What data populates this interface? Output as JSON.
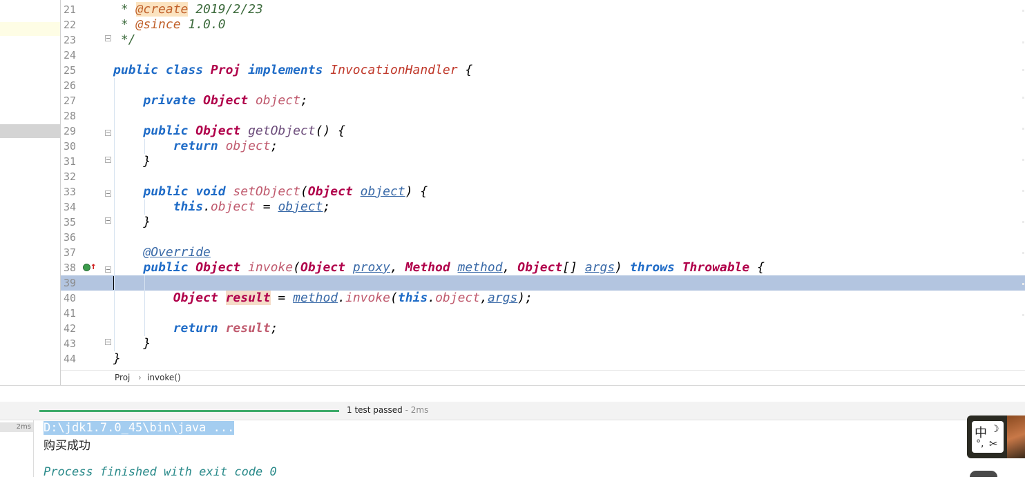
{
  "editor": {
    "lines": [
      {
        "n": "21",
        "segs": [
          {
            "c": "cmt",
            "t": " * "
          },
          {
            "c": "tag-hl",
            "t": "@create"
          },
          {
            "c": "cmt",
            "t": " 2019/2/23"
          }
        ]
      },
      {
        "n": "22",
        "segs": [
          {
            "c": "cmt",
            "t": " * "
          },
          {
            "c": "tag",
            "t": "@since"
          },
          {
            "c": "cmt",
            "t": " 1.0.0"
          }
        ]
      },
      {
        "n": "23",
        "segs": [
          {
            "c": "cmt",
            "t": " */"
          }
        ]
      },
      {
        "n": "24",
        "segs": []
      },
      {
        "n": "25",
        "segs": [
          {
            "c": "kw",
            "t": "public class "
          },
          {
            "c": "type",
            "t": "Proj "
          },
          {
            "c": "kw",
            "t": "implements "
          },
          {
            "c": "iface",
            "t": "InvocationHandler"
          },
          {
            "c": "",
            "t": " {"
          }
        ]
      },
      {
        "n": "26",
        "segs": []
      },
      {
        "n": "27",
        "segs": [
          {
            "c": "",
            "t": "    "
          },
          {
            "c": "kw",
            "t": "private "
          },
          {
            "c": "type",
            "t": "Object "
          },
          {
            "c": "fld",
            "t": "object"
          },
          {
            "c": "",
            "t": ";"
          }
        ]
      },
      {
        "n": "28",
        "segs": []
      },
      {
        "n": "29",
        "segs": [
          {
            "c": "",
            "t": "    "
          },
          {
            "c": "kw",
            "t": "public "
          },
          {
            "c": "type",
            "t": "Object "
          },
          {
            "c": "mth",
            "t": "getObject"
          },
          {
            "c": "",
            "t": "() {"
          }
        ]
      },
      {
        "n": "30",
        "segs": [
          {
            "c": "",
            "t": "        "
          },
          {
            "c": "kw",
            "t": "return "
          },
          {
            "c": "fld",
            "t": "object"
          },
          {
            "c": "",
            "t": ";"
          }
        ]
      },
      {
        "n": "31",
        "segs": [
          {
            "c": "",
            "t": "    }"
          }
        ]
      },
      {
        "n": "32",
        "segs": []
      },
      {
        "n": "33",
        "segs": [
          {
            "c": "",
            "t": "    "
          },
          {
            "c": "kw",
            "t": "public void "
          },
          {
            "c": "fld",
            "t": "setObject"
          },
          {
            "c": "",
            "t": "("
          },
          {
            "c": "type",
            "t": "Object "
          },
          {
            "c": "prm",
            "t": "object"
          },
          {
            "c": "",
            "t": ") {"
          }
        ]
      },
      {
        "n": "34",
        "segs": [
          {
            "c": "",
            "t": "        "
          },
          {
            "c": "kw",
            "t": "this"
          },
          {
            "c": "",
            "t": "."
          },
          {
            "c": "fld",
            "t": "object"
          },
          {
            "c": "",
            "t": " = "
          },
          {
            "c": "prm",
            "t": "object"
          },
          {
            "c": "",
            "t": ";"
          }
        ]
      },
      {
        "n": "35",
        "segs": [
          {
            "c": "",
            "t": "    }"
          }
        ]
      },
      {
        "n": "36",
        "segs": []
      },
      {
        "n": "37",
        "segs": [
          {
            "c": "",
            "t": "    "
          },
          {
            "c": "prm",
            "t": "@Override"
          }
        ]
      },
      {
        "n": "38",
        "segs": [
          {
            "c": "",
            "t": "    "
          },
          {
            "c": "kw",
            "t": "public "
          },
          {
            "c": "type",
            "t": "Object "
          },
          {
            "c": "fld",
            "t": "invoke"
          },
          {
            "c": "",
            "t": "("
          },
          {
            "c": "type",
            "t": "Object "
          },
          {
            "c": "prm",
            "t": "proxy"
          },
          {
            "c": "",
            "t": ", "
          },
          {
            "c": "type",
            "t": "Method "
          },
          {
            "c": "prm",
            "t": "method"
          },
          {
            "c": "",
            "t": ", "
          },
          {
            "c": "type",
            "t": "Object"
          },
          {
            "c": "",
            "t": "[] "
          },
          {
            "c": "prm",
            "t": "args"
          },
          {
            "c": "",
            "t": ") "
          },
          {
            "c": "kw",
            "t": "throws "
          },
          {
            "c": "type",
            "t": "Throwable"
          },
          {
            "c": "",
            "t": " {"
          }
        ]
      },
      {
        "n": "39",
        "segs": []
      },
      {
        "n": "40",
        "segs": [
          {
            "c": "",
            "t": "        "
          },
          {
            "c": "type",
            "t": "Object "
          },
          {
            "c": "var-hl",
            "t": "result"
          },
          {
            "c": "",
            "t": " = "
          },
          {
            "c": "prm",
            "t": "method"
          },
          {
            "c": "",
            "t": "."
          },
          {
            "c": "fld",
            "t": "invoke"
          },
          {
            "c": "",
            "t": "("
          },
          {
            "c": "kw",
            "t": "this"
          },
          {
            "c": "",
            "t": "."
          },
          {
            "c": "fld",
            "t": "object"
          },
          {
            "c": "",
            "t": ","
          },
          {
            "c": "prm",
            "t": "args"
          },
          {
            "c": "",
            "t": ");"
          }
        ]
      },
      {
        "n": "41",
        "segs": []
      },
      {
        "n": "42",
        "segs": [
          {
            "c": "",
            "t": "        "
          },
          {
            "c": "kw",
            "t": "return "
          },
          {
            "c": "loc",
            "t": "result"
          },
          {
            "c": "",
            "t": ";"
          }
        ]
      },
      {
        "n": "43",
        "segs": [
          {
            "c": "",
            "t": "    }"
          }
        ]
      },
      {
        "n": "44",
        "segs": [
          {
            "c": "",
            "t": "}"
          }
        ]
      }
    ]
  },
  "breadcrumb": {
    "items": [
      "Proj",
      "invoke()"
    ],
    "separator": "›"
  },
  "tests": {
    "status": "1 test passed",
    "time": " - 2ms",
    "badge": "2ms"
  },
  "console": {
    "command": "D:\\jdk1.7.0_45\\bin\\java ...",
    "output": "购买成功",
    "exit": "Process finished with exit code 0"
  },
  "ime": {
    "lang": "中",
    "moon": "☽",
    "punct": "°,",
    "fly": "✂"
  },
  "colors": {
    "selection": "#b3c5e0",
    "keyword": "#1e6bc7",
    "type": "#b0004a",
    "pass": "#3daa6a"
  }
}
